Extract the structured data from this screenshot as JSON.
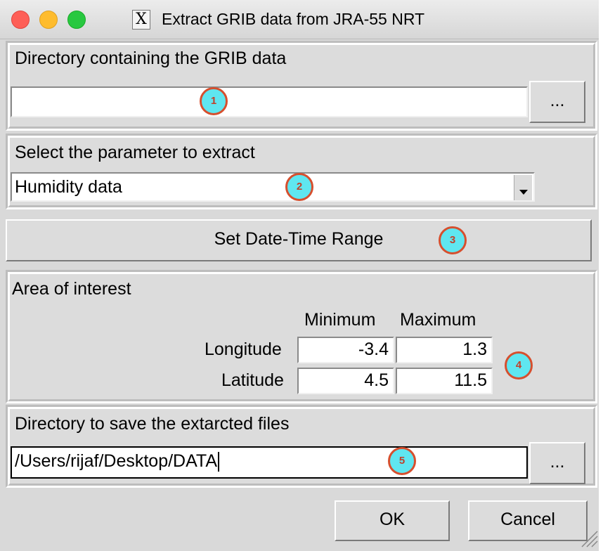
{
  "window": {
    "title": "Extract GRIB data from JRA-55 NRT",
    "title_icon_glyph": "X"
  },
  "grib_dir": {
    "label": "Directory containing the GRIB data",
    "value": "",
    "browse_label": "...",
    "badge": "1"
  },
  "parameter": {
    "label": "Select the parameter to extract",
    "selected": "Humidity data",
    "badge": "2"
  },
  "date_range": {
    "button_label": "Set Date-Time Range",
    "badge": "3"
  },
  "area": {
    "label": "Area of interest",
    "col_min": "Minimum",
    "col_max": "Maximum",
    "longitude": {
      "label": "Longitude",
      "min": "-3.4",
      "max": "1.3"
    },
    "latitude": {
      "label": "Latitude",
      "min": "4.5",
      "max": "11.5"
    },
    "badge": "4"
  },
  "save_dir": {
    "label": "Directory to save the extarcted files",
    "value": "/Users/rijaf/Desktop/DATA",
    "browse_label": "...",
    "badge": "5"
  },
  "actions": {
    "ok_label": "OK",
    "cancel_label": "Cancel"
  },
  "colors": {
    "badge_fill": "#5fe6f0",
    "badge_ring": "#d64f2e"
  }
}
